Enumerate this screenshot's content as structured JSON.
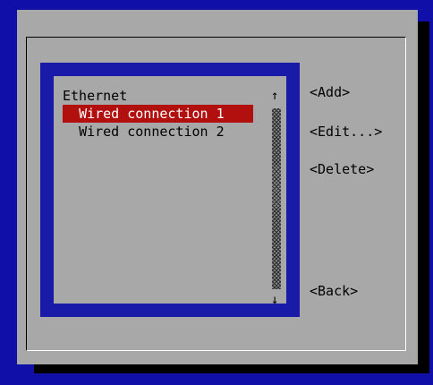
{
  "list": {
    "header": "Ethernet",
    "items": [
      {
        "label": "Wired connection 1",
        "selected": true
      },
      {
        "label": "Wired connection 2",
        "selected": false
      }
    ],
    "scroll_up_glyph": "↑",
    "scroll_down_glyph": "↓"
  },
  "buttons": {
    "add": "<Add>",
    "edit": "<Edit...>",
    "delete": "<Delete>",
    "back": "<Back>"
  },
  "colors": {
    "background": "#1010a8",
    "dialog": "#a8a8a8",
    "selection": "#b20f0f",
    "shadow": "#000000"
  }
}
